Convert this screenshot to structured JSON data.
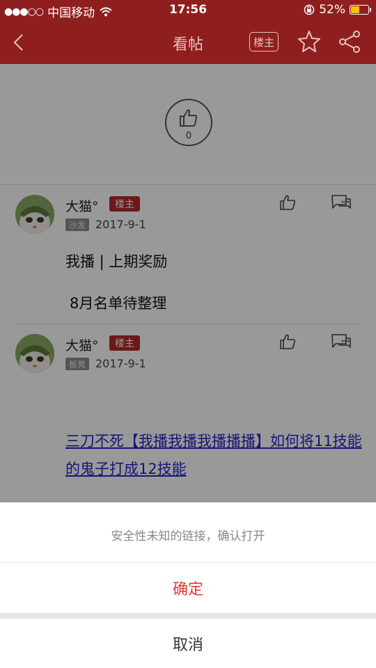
{
  "status_bar": {
    "signal": "●●●○○",
    "carrier": "中国移动",
    "time": "17:56",
    "battery_pct": "52%",
    "battery_level": 0.52
  },
  "navbar": {
    "title": "看帖",
    "owner_badge": "楼主"
  },
  "top_like": {
    "count": "0"
  },
  "posts": [
    {
      "username": "大猫°",
      "owner_badge": "楼主",
      "floor": "沙发",
      "date": "2017-9-1",
      "lines": [
        "我播 | 上期奖励",
        "8月名单待整理"
      ]
    },
    {
      "username": "大猫°",
      "owner_badge": "楼主",
      "floor": "板凳",
      "date": "2017-9-1",
      "link": "三刀不死【我播我播我播播播】如何将11技能的鬼子打成12技能"
    }
  ],
  "action_sheet": {
    "message": "安全性未知的链接，确认打开",
    "confirm": "确定",
    "cancel": "取消"
  },
  "colors": {
    "brand": "#8f1f1f",
    "badge": "#b4292b",
    "confirm": "#e03a2f",
    "link": "#2424c8"
  }
}
